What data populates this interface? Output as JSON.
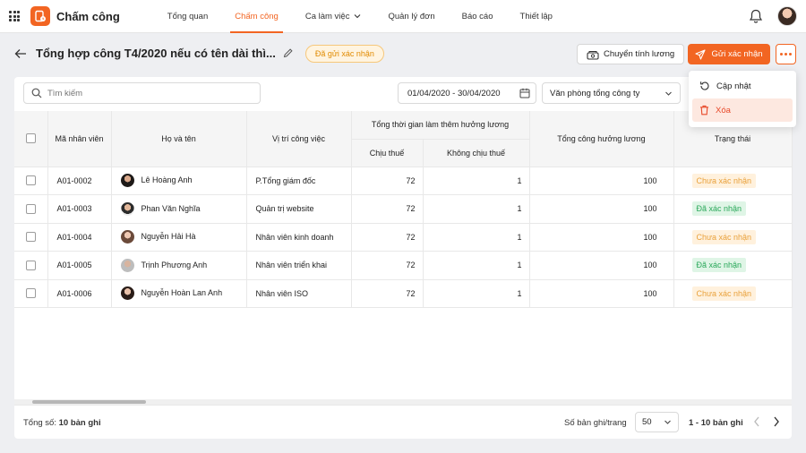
{
  "app": {
    "title": "Chấm công"
  },
  "nav": {
    "items": [
      {
        "label": "Tổng quan",
        "active": false
      },
      {
        "label": "Chấm công",
        "active": true
      },
      {
        "label": "Ca làm việc",
        "active": false,
        "dropdown": true
      },
      {
        "label": "Quản lý đơn",
        "active": false
      },
      {
        "label": "Báo cáo",
        "active": false
      },
      {
        "label": "Thiết lập",
        "active": false
      }
    ]
  },
  "page": {
    "title": "Tổng hợp công T4/2020 nếu có tên dài thì...",
    "status": "Đã gửi xác nhận",
    "transfer_label": "Chuyển tính lương",
    "send_label": "Gửi xác nhận"
  },
  "menu": {
    "update_label": "Cập nhật",
    "delete_label": "Xóa"
  },
  "filters": {
    "search_placeholder": "Tìm kiếm",
    "date_range": "01/04/2020 - 30/04/2020",
    "office": "Văn phòng tổng công ty"
  },
  "table": {
    "headers": {
      "id": "Mã nhân viên",
      "name": "Họ và tên",
      "position": "Vị trí công việc",
      "overtime_group": "Tổng thời gian làm thêm hưởng lương",
      "taxable": "Chịu thuế",
      "nontaxable": "Không chịu thuế",
      "paid_total": "Tổng công hưởng lương",
      "status": "Trạng thái"
    },
    "rows": [
      {
        "id": "A01-0002",
        "name": "Lê Hoàng Anh",
        "position": "P.Tổng giám đốc",
        "taxable": "72",
        "nontaxable": "1",
        "paid_total": "100",
        "status": "Chưa xác nhận",
        "confirmed": false
      },
      {
        "id": "A01-0003",
        "name": "Phan Văn Nghĩa",
        "position": "Quản trị website",
        "taxable": "72",
        "nontaxable": "1",
        "paid_total": "100",
        "status": "Đã xác nhận",
        "confirmed": true
      },
      {
        "id": "A01-0004",
        "name": "Nguyễn Hải Hà",
        "position": "Nhân viên kinh doanh",
        "taxable": "72",
        "nontaxable": "1",
        "paid_total": "100",
        "status": "Chưa xác nhận",
        "confirmed": false
      },
      {
        "id": "A01-0005",
        "name": "Trịnh Phương Anh",
        "position": "Nhân viên triển khai",
        "taxable": "72",
        "nontaxable": "1",
        "paid_total": "100",
        "status": "Đã xác nhận",
        "confirmed": true
      },
      {
        "id": "A01-0006",
        "name": "Nguyễn Hoàn Lan Anh",
        "position": "Nhân viên ISO",
        "taxable": "72",
        "nontaxable": "1",
        "paid_total": "100",
        "status": "Chưa xác nhận",
        "confirmed": false
      }
    ]
  },
  "footer": {
    "total_prefix": "Tổng số:",
    "total_count": "10 bản ghi",
    "per_page_label": "Số bản ghi/trang",
    "per_page_value": "50",
    "range": "1 - 10 bản ghi"
  },
  "colors": {
    "accent": "#f26522",
    "pending": "#e9a13b",
    "confirmed": "#2aa85a"
  },
  "icons": [
    "apps-grid-icon",
    "app-logo-icon",
    "bell-icon",
    "arrow-left-icon",
    "pencil-icon",
    "cash-icon",
    "send-icon",
    "more-icon",
    "refresh-icon",
    "trash-icon",
    "search-icon",
    "calendar-icon",
    "chevron-down-icon",
    "chevron-left-icon",
    "chevron-right-icon"
  ]
}
